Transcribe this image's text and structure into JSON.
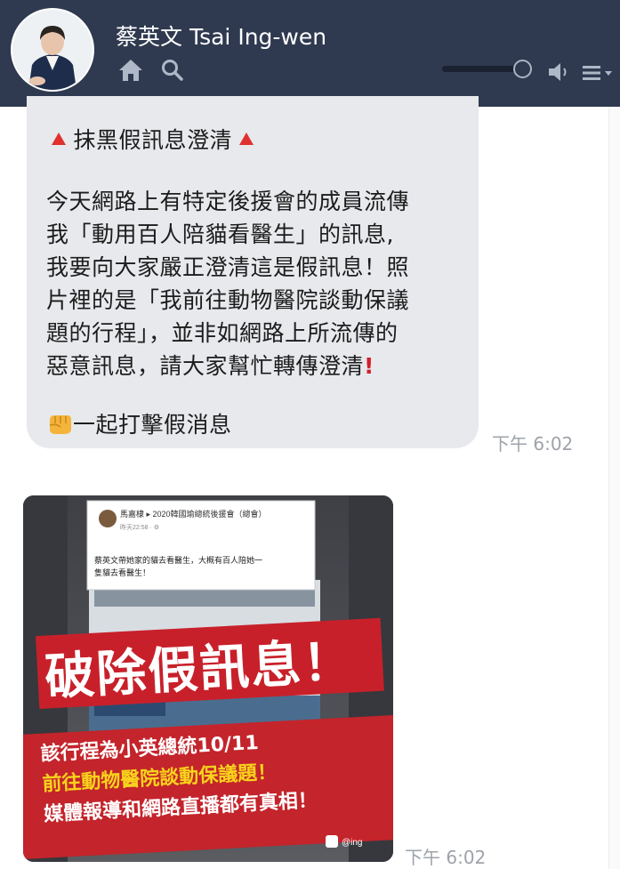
{
  "header": {
    "title": "蔡英文 Tsai Ing-wen",
    "icons": [
      "home-icon",
      "search-icon",
      "volume-icon",
      "menu-icon"
    ],
    "colors": {
      "background": "#2f3a50",
      "text": "#ffffff"
    }
  },
  "messages": [
    {
      "type": "text",
      "lines": [
        "抹黑假訊息澄清",
        "今天網路上有特定後援會的成員流傳",
        "我「動用百人陪貓看醫生」的訊息,",
        "我要向大家嚴正澄清這是假訊息！照",
        "片裡的是「我前往動物醫院談動保議",
        "題的行程」，並非如網路上所流傳的",
        "惡意訊息，請大家幫忙轉傳澄清",
        "一起打擊假消息"
      ],
      "icons": [
        "red-triangle-icon",
        "red-exclamation-icon",
        "fist-emoji-icon"
      ],
      "time": "下午 6:02"
    },
    {
      "type": "image",
      "post": {
        "name": "馬嘉棣 ▸ 2020韓國瑜總統後援會（總會）",
        "meta": "昨天22:58 · ⚙",
        "text_line1": "蔡英文帶她家的貓去看醫生，大概有百人陪她一",
        "text_line2": "隻貓去看醫生！"
      },
      "headline": "破除假訊息！",
      "caption_line1": "該行程為小英總統10/11",
      "caption_line2": "前往動物醫院談動保議題！",
      "caption_line3": "媒體報導和網路直播都有真相！",
      "watermark": "@ing",
      "time": "下午 6:02"
    }
  ]
}
